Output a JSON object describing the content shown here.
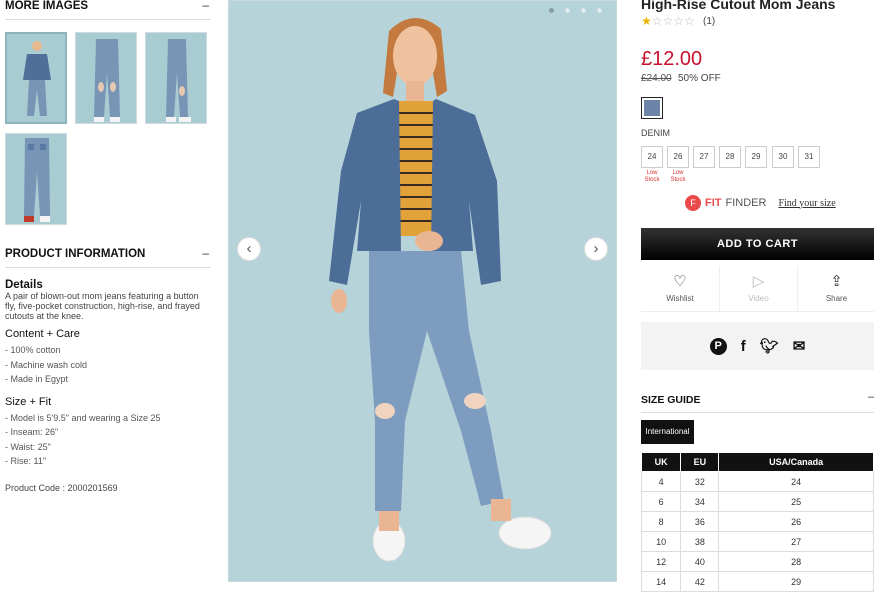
{
  "left": {
    "more_images": {
      "title": "MORE IMAGES",
      "toggle": "–"
    },
    "product_information": {
      "title": "PRODUCT INFORMATION",
      "toggle": "–"
    },
    "details": {
      "title": "Details",
      "text": "A pair of blown-out mom jeans featuring a button fly, five-pocket construction, high-rise, and frayed cutouts at the knee."
    },
    "content_care": {
      "title": "Content + Care",
      "items": [
        "- 100% cotton",
        "- Machine wash cold",
        "- Made in Egypt"
      ]
    },
    "size_fit": {
      "title": "Size + Fit",
      "items": [
        "- Model is 5'9.5\" and wearing a Size 25",
        "- Inseam: 26\"",
        "- Waist: 25\"",
        "- Rise: 11\""
      ]
    },
    "product_code": "Product Code : 2000201569"
  },
  "gallery": {
    "prev": "‹",
    "next": "›"
  },
  "product": {
    "title": "High-Rise Cutout Mom Jeans",
    "stars": "★☆☆☆☆",
    "review_count": "(1)",
    "price": "£12.00",
    "old_price": "£24.00",
    "discount": "50% OFF",
    "color_name": "DENIM",
    "swatch_color": "#6a83a6",
    "sizes": [
      "24",
      "26",
      "27",
      "28",
      "29",
      "30",
      "31"
    ],
    "low_stock_label": "Low Stock",
    "fit_finder": {
      "fit": "FIT",
      "finder": "FINDER",
      "link": "Find your size",
      "icon": "F"
    },
    "add_to_cart": "ADD TO CART",
    "actions": {
      "wishlist": "Wishlist",
      "video": "Video",
      "share": "Share"
    }
  },
  "size_guide": {
    "title": "SIZE GUIDE",
    "toggle": "–",
    "tab": "International",
    "headers": [
      "UK",
      "EU",
      "USA/Canada"
    ],
    "rows": [
      [
        "4",
        "32",
        "24"
      ],
      [
        "6",
        "34",
        "25"
      ],
      [
        "8",
        "36",
        "26"
      ],
      [
        "10",
        "38",
        "27"
      ],
      [
        "12",
        "40",
        "28"
      ],
      [
        "14",
        "42",
        "29"
      ]
    ]
  },
  "colors": {
    "accent_red": "#c8102e",
    "fit_red": "#e94b4b",
    "bg_image": "#b5d3d8"
  }
}
